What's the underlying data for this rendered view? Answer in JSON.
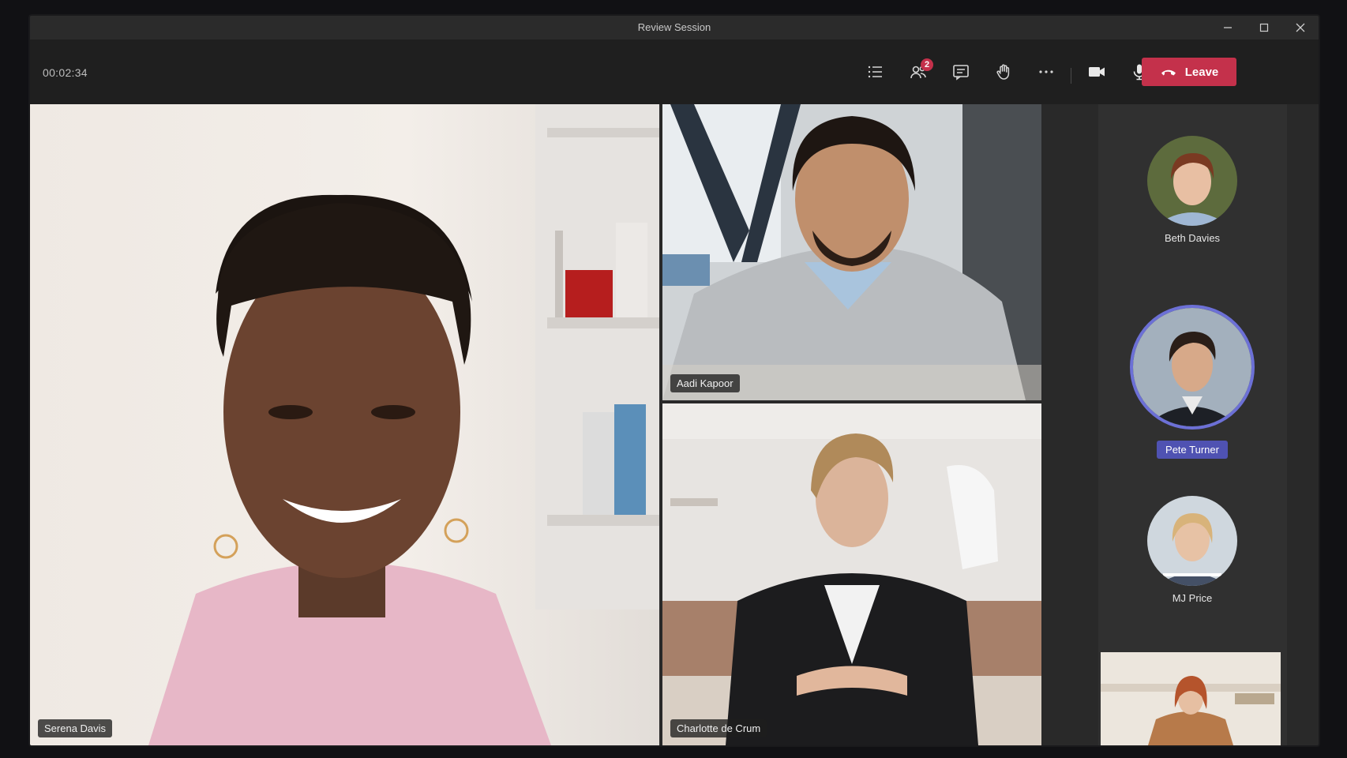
{
  "window": {
    "title": "Review Session"
  },
  "toolbar": {
    "timer": "00:02:34",
    "participants_badge": "2",
    "leave_label": "Leave",
    "icons": [
      "list-icon",
      "participants-icon",
      "chat-icon",
      "raise-hand-icon",
      "more-icon",
      "camera-icon",
      "mic-icon",
      "share-icon",
      "phone-hangup-icon"
    ]
  },
  "tiles": {
    "main": {
      "name": "Serena Davis"
    },
    "top_right": {
      "name": "Aadi Kapoor"
    },
    "bottom_right": {
      "name": "Charlotte de Crum"
    }
  },
  "roster": {
    "p1": {
      "name": "Beth Davies"
    },
    "p2": {
      "name": "Pete Turner"
    },
    "p3": {
      "name": "MJ Price"
    }
  },
  "colors": {
    "leave": "#c4314b",
    "active": "#4f52b2",
    "toolbar": "#1f1f1f"
  }
}
